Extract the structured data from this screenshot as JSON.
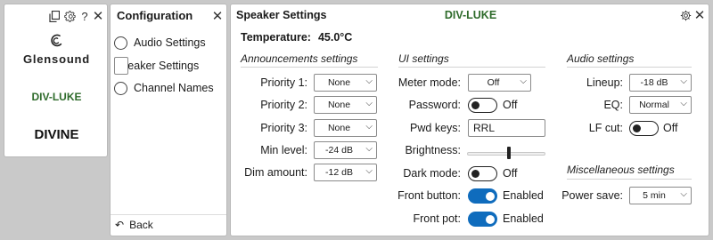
{
  "colors": {
    "accent": "#0f6cbd",
    "device_id_green": "#2e6b2b"
  },
  "device_panel": {
    "icons": [
      "copy-icon",
      "gear-icon",
      "help-icon",
      "close-icon"
    ],
    "help_glyph": "?",
    "logo_text": "Glensound",
    "device_id": "DIV-LUKE",
    "device_name": "DIVINE"
  },
  "config_panel": {
    "title": "Configuration",
    "items": [
      {
        "label": "Audio Settings",
        "selected": false
      },
      {
        "label": "Speaker Settings",
        "selected": true
      },
      {
        "label": "Channel Names",
        "selected": false
      }
    ],
    "back_label": "Back"
  },
  "speaker_panel": {
    "title": "Speaker Settings",
    "device_id": "DIV-LUKE",
    "temperature_label": "Temperature:",
    "temperature_value": "45.0°C",
    "announcements": {
      "heading": "Announcements settings",
      "priority1_label": "Priority 1:",
      "priority1_value": "None",
      "priority2_label": "Priority 2:",
      "priority2_value": "None",
      "priority3_label": "Priority 3:",
      "priority3_value": "None",
      "min_level_label": "Min level:",
      "min_level_value": "-24 dB",
      "dim_amount_label": "Dim amount:",
      "dim_amount_value": "-12 dB"
    },
    "ui_settings": {
      "heading": "UI settings",
      "meter_mode_label": "Meter mode:",
      "meter_mode_value": "Off",
      "password_label": "Password:",
      "password_state": "Off",
      "pwd_keys_label": "Pwd keys:",
      "pwd_keys_value": "RRL",
      "brightness_label": "Brightness:",
      "brightness_level": 0.53,
      "dark_mode_label": "Dark mode:",
      "dark_mode_state": "Off",
      "front_button_label": "Front button:",
      "front_button_state": "Enabled",
      "front_pot_label": "Front pot:",
      "front_pot_state": "Enabled"
    },
    "audio_settings": {
      "heading": "Audio settings",
      "lineup_label": "Lineup:",
      "lineup_value": "-18 dB",
      "eq_label": "EQ:",
      "eq_value": "Normal",
      "lf_cut_label": "LF cut:",
      "lf_cut_state": "Off"
    },
    "misc_settings": {
      "heading": "Miscellaneous settings",
      "power_save_label": "Power save:",
      "power_save_value": "5 min"
    }
  }
}
